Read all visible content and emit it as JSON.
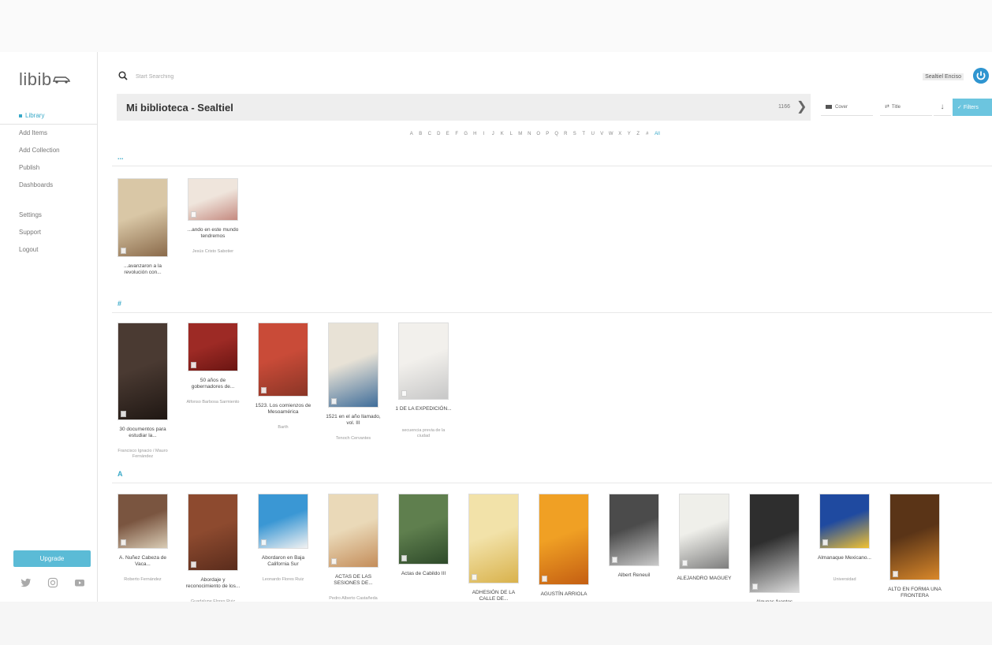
{
  "app": {
    "logo": "libib"
  },
  "sidebar": {
    "items": [
      {
        "label": "Library",
        "active": true
      },
      {
        "label": "Add Items"
      },
      {
        "label": "Add Collection"
      },
      {
        "label": "Publish"
      },
      {
        "label": "Dashboards"
      },
      {
        "label": "Settings"
      },
      {
        "label": "Support"
      },
      {
        "label": "Logout"
      }
    ],
    "upgrade_label": "Upgrade",
    "social": [
      "twitter-icon",
      "instagram-icon",
      "youtube-icon"
    ]
  },
  "topbar": {
    "search_placeholder": "Start Searching",
    "user_name": "Sealtiel Enciso"
  },
  "library": {
    "title": "Mi biblioteca - Sealtiel",
    "count": "1166",
    "view_label": "Cover",
    "sort_label": "Title",
    "filters_label": "Filters",
    "letters": [
      "A",
      "B",
      "C",
      "D",
      "E",
      "F",
      "G",
      "H",
      "I",
      "J",
      "K",
      "L",
      "M",
      "N",
      "O",
      "P",
      "Q",
      "R",
      "S",
      "T",
      "U",
      "V",
      "W",
      "X",
      "Y",
      "Z",
      "#"
    ],
    "all_label": "All"
  },
  "sections": [
    {
      "letter": "...",
      "books": [
        {
          "title": "...avanzaron a la revolución con...",
          "author": "",
          "cover": [
            "#d9c7a6",
            "#8a6a4a"
          ]
        },
        {
          "title": "...ando en este mundo tendremos",
          "author": "Jesús Cristo Sabotier",
          "cover": [
            "#efe5dc",
            "#c58a80"
          ]
        }
      ]
    },
    {
      "letter": "#",
      "books": [
        {
          "title": "30 documentos para estudiar la...",
          "author": "Francisco Ignacio / Mauro Fernández",
          "cover": [
            "#4a3a32",
            "#1f1713"
          ]
        },
        {
          "title": "50 años de gobernadores de...",
          "author": "Alfonso Barbosa Sarmiento",
          "cover": [
            "#9d2a25",
            "#6a1512"
          ]
        },
        {
          "title": "1523. Los comienzos de Mesoamérica",
          "author": "Barth",
          "cover": [
            "#c94b38",
            "#8a3526"
          ]
        },
        {
          "title": "1521 en el año llamado, vol. III",
          "author": "Tenoch Cervantes",
          "cover": [
            "#e8e2d6",
            "#3f6d9a"
          ]
        },
        {
          "title": "1 DE LA EXPEDICIÓN...",
          "author": "secuencia previa de la ciudad",
          "cover": [
            "#f2f0ec",
            "#c7c7c7"
          ]
        }
      ]
    },
    {
      "letter": "A",
      "books": [
        {
          "title": "A. Nuñez Cabeza de Vaca...",
          "author": "Roberto Fernández",
          "cover": [
            "#7a5540",
            "#d9ccb5"
          ]
        },
        {
          "title": "Abordaje y reconocimiento de los...",
          "author": "Guadalupe Flores Ruiz",
          "cover": [
            "#8d4a2f",
            "#5a2c1c"
          ]
        },
        {
          "title": "Abordaron en Baja California Sur",
          "author": "Leonardo Flores Ruiz",
          "cover": [
            "#3a97d4",
            "#f2f2f2"
          ]
        },
        {
          "title": "ACTAS DE LAS SESIONES DE...",
          "author": "Pedro Alberto Castañeda",
          "cover": [
            "#ead9b8",
            "#c48d5a"
          ]
        },
        {
          "title": "Actas de Cabildo III",
          "author": "",
          "cover": [
            "#5f7f4e",
            "#2e4a2a"
          ]
        },
        {
          "title": "ADHESIÓN DE LA CALLE DE...",
          "author": "",
          "cover": [
            "#f2e2a9",
            "#d9b24c"
          ]
        },
        {
          "title": "AGUSTÍN ARRIOLA",
          "author": "",
          "cover": [
            "#f0a024",
            "#c45e12"
          ]
        },
        {
          "title": "Albert Reneuil",
          "author": "",
          "cover": [
            "#4b4b4b",
            "#c9c9c9"
          ]
        },
        {
          "title": "ALEJANDRO MAGUEY",
          "author": "",
          "cover": [
            "#efefea",
            "#7d7d7d"
          ]
        },
        {
          "title": "Algunas fuentes",
          "author": "",
          "cover": [
            "#2e2e2e",
            "#dcdcdc"
          ]
        },
        {
          "title": "Almanaque Mexicano...",
          "author": "Universidad",
          "cover": [
            "#1f4aa0",
            "#f1c232"
          ]
        },
        {
          "title": "ALTO EN FORMA UNA FRONTERA",
          "author": "",
          "cover": [
            "#5a3417",
            "#d9882a"
          ]
        }
      ]
    }
  ]
}
